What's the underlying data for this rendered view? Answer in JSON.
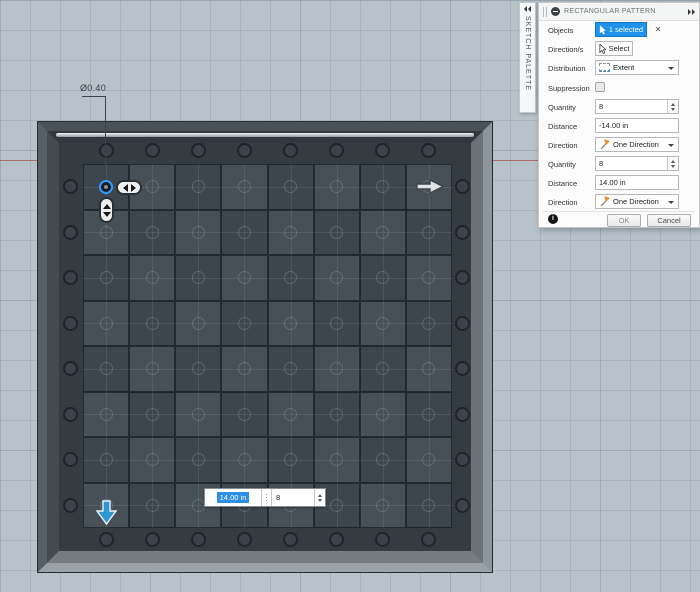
{
  "canvas": {
    "dimension_label": "Ø0.40",
    "inline_distance": "14.00 in",
    "inline_quantity": "8"
  },
  "pattern": {
    "rows": 8,
    "cols": 8
  },
  "palette_tab": {
    "label": "SKETCH PALETTE"
  },
  "dialog": {
    "title": "RECTANGULAR PATTERN",
    "fields": {
      "objects": {
        "label": "Objects",
        "value": "1 selected",
        "clear": "✕"
      },
      "directions": {
        "label": "Direction/s",
        "value": "Select"
      },
      "distribution": {
        "label": "Distribution",
        "value": "Extent"
      },
      "suppression": {
        "label": "Suppression"
      },
      "quantity1": {
        "label": "Quantity",
        "value": "8"
      },
      "distance1": {
        "label": "Distance",
        "value": "-14.00 in"
      },
      "direction1": {
        "label": "Direction",
        "value": "One Direction"
      },
      "quantity2": {
        "label": "Quantity",
        "value": "8"
      },
      "distance2": {
        "label": "Distance",
        "value": "14.00 in"
      },
      "direction2": {
        "label": "Direction",
        "value": "One Direction"
      }
    },
    "footer": {
      "info": "i",
      "ok": "OK",
      "cancel": "Cancel"
    }
  },
  "colors": {
    "accent_blue": "#1f92ed",
    "selection_blue": "#2f9bff",
    "axis_red": "#b05c5c",
    "canvas_bg": "#b7c2ca"
  }
}
